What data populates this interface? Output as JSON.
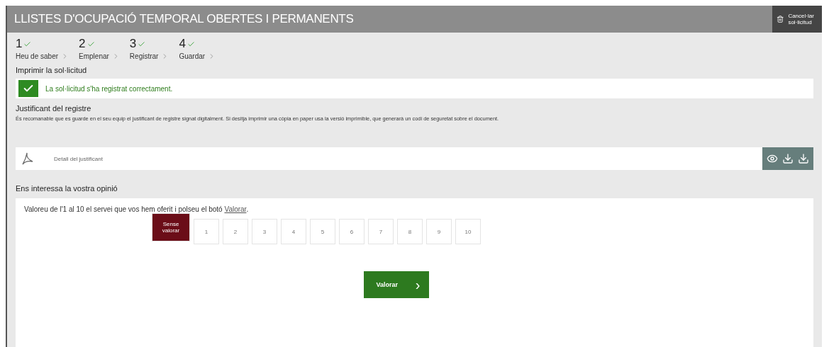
{
  "header": {
    "title": "LLISTES D'OCUPACIÓ TEMPORAL OBERTES I PERMANENTS",
    "cancel_button": "Cancel·lar sol·licitud"
  },
  "steps": [
    {
      "number": "1",
      "label": "Heu de saber",
      "done": true
    },
    {
      "number": "2",
      "label": "Emplenar",
      "done": true
    },
    {
      "number": "3",
      "label": "Registrar",
      "done": true
    },
    {
      "number": "4",
      "label": "Guardar",
      "done": true
    }
  ],
  "print_section": {
    "title": "Imprimir la sol·licitud",
    "success_message": "La sol·licitud s'ha registrat correctament."
  },
  "receipt": {
    "title": "Justificant del registre",
    "description": "És recomanable que es guarde en el seu equip el justificant de registre signat digitalment. Si desitja imprimir una còpia en paper usa la versió imprimible, que generarà un codi de seguretat sobre el document.",
    "document": "Detall del justificant"
  },
  "feedback": {
    "title": "Ens interessa la vostra opinió",
    "prompt": "Valoreu de l'1 al 10 el servei que vos hem oferit i polseu el botó ",
    "link": "Valorar",
    "prompt_end": ".",
    "options": [
      {
        "label": "Sense valorar",
        "kind": "none",
        "selected": true
      },
      {
        "label": "1",
        "kind": "score",
        "selected": false
      },
      {
        "label": "2",
        "kind": "score",
        "selected": false
      },
      {
        "label": "3",
        "kind": "score",
        "selected": false
      },
      {
        "label": "4",
        "kind": "score",
        "selected": false
      },
      {
        "label": "5",
        "kind": "score",
        "selected": false
      },
      {
        "label": "6",
        "kind": "score",
        "selected": false
      },
      {
        "label": "7",
        "kind": "score",
        "selected": false
      },
      {
        "label": "8",
        "kind": "score",
        "selected": false
      },
      {
        "label": "9",
        "kind": "score",
        "selected": false
      },
      {
        "label": "10",
        "kind": "score",
        "selected": false
      }
    ],
    "submit": "Valorar",
    "submit_arrow": "›"
  }
}
